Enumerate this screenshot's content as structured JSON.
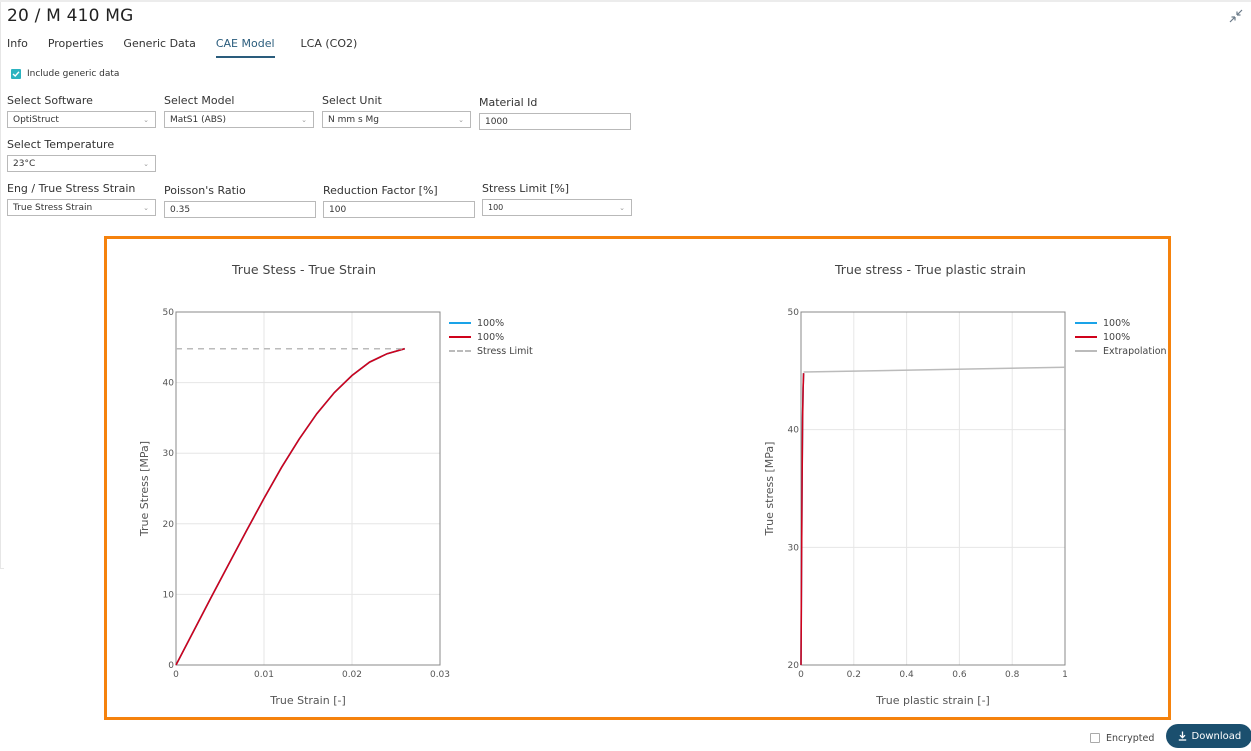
{
  "header": {
    "title": "20 / M 410 MG",
    "collapse_icon": "collapse-arrows-icon"
  },
  "tabs": [
    {
      "label": "Info",
      "active": false
    },
    {
      "label": "Properties",
      "active": false
    },
    {
      "label": "Generic Data",
      "active": false
    },
    {
      "label": "CAE Model",
      "active": true
    },
    {
      "label": "LCA (CO2)",
      "active": false
    }
  ],
  "include_generic": {
    "label": "Include generic data",
    "checked": true
  },
  "form": {
    "software": {
      "label": "Select Software",
      "value": "OptiStruct"
    },
    "model": {
      "label": "Select Model",
      "value": "MatS1 (ABS)"
    },
    "unit": {
      "label": "Select Unit",
      "value": "N mm s Mg"
    },
    "material_id": {
      "label": "Material Id",
      "value": "1000"
    },
    "temperature": {
      "label": "Select Temperature",
      "value": "23°C"
    },
    "stress_strain": {
      "label": "Eng / True Stress Strain",
      "value": "True Stress Strain"
    },
    "poisson": {
      "label": "Poisson's Ratio",
      "value": "0.35"
    },
    "reduction": {
      "label": "Reduction Factor [%]",
      "value": "100"
    },
    "stress_limit": {
      "label": "Stress Limit [%]",
      "value": "100"
    }
  },
  "colors": {
    "accent": "#2a5c7c",
    "checkbox": "#2bb3c0",
    "highlight_border": "#f5820d",
    "series_blue": "#1aa3e8",
    "series_red": "#d0021b",
    "gray": "#bbbbbb",
    "download_bg": "#1b4f6e"
  },
  "chart_data": [
    {
      "type": "line",
      "title": "True Stess - True Strain",
      "xlabel": "True Strain [-]",
      "ylabel": "True Stress [MPa]",
      "xlim": [
        0,
        0.03
      ],
      "ylim": [
        0,
        50
      ],
      "xticks": [
        "0",
        "0.01",
        "0.02",
        "0.03"
      ],
      "yticks": [
        "0",
        "10",
        "20",
        "30",
        "40",
        "50"
      ],
      "grid": true,
      "legend_position": "right",
      "series": [
        {
          "name": "100%",
          "color": "#1aa3e8",
          "style": "solid",
          "x": [
            0,
            0.002,
            0.004,
            0.006,
            0.008,
            0.01,
            0.012,
            0.014,
            0.016,
            0.018,
            0.02,
            0.022,
            0.024,
            0.026
          ],
          "y": [
            0,
            4.8,
            9.6,
            14.3,
            19.0,
            23.6,
            28.0,
            32.0,
            35.6,
            38.6,
            41.0,
            42.9,
            44.1,
            44.8
          ]
        },
        {
          "name": "100%",
          "color": "#d0021b",
          "style": "solid",
          "x": [
            0,
            0.002,
            0.004,
            0.006,
            0.008,
            0.01,
            0.012,
            0.014,
            0.016,
            0.018,
            0.02,
            0.022,
            0.024,
            0.026
          ],
          "y": [
            0,
            4.8,
            9.6,
            14.3,
            19.0,
            23.6,
            28.0,
            32.0,
            35.6,
            38.6,
            41.0,
            42.9,
            44.1,
            44.8
          ]
        },
        {
          "name": "Stress Limit",
          "color": "#bbbbbb",
          "style": "dashed",
          "x": [
            0,
            0.026
          ],
          "y": [
            44.8,
            44.8
          ]
        }
      ]
    },
    {
      "type": "line",
      "title": "True stress - True plastic strain",
      "xlabel": "True plastic strain [-]",
      "ylabel": "True stress [MPa]",
      "xlim": [
        0,
        1
      ],
      "ylim": [
        20,
        50
      ],
      "xticks": [
        "0",
        "0.2",
        "0.4",
        "0.6",
        "0.8",
        "1"
      ],
      "yticks": [
        "20",
        "30",
        "40",
        "50"
      ],
      "grid": true,
      "legend_position": "right",
      "series": [
        {
          "name": "100%",
          "color": "#1aa3e8",
          "style": "solid",
          "x": [
            0,
            0.002,
            0.004,
            0.006,
            0.008,
            0.01
          ],
          "y": [
            20,
            28,
            36,
            41,
            43.5,
            44.8
          ]
        },
        {
          "name": "100%",
          "color": "#d0021b",
          "style": "solid",
          "x": [
            0,
            0.002,
            0.004,
            0.006,
            0.008,
            0.01
          ],
          "y": [
            20,
            28,
            36,
            41,
            43.5,
            44.8
          ]
        },
        {
          "name": "Extrapolation",
          "color": "#bbbbbb",
          "style": "solid",
          "x": [
            0.01,
            1
          ],
          "y": [
            44.9,
            45.3
          ]
        }
      ]
    }
  ],
  "footer": {
    "encrypted": {
      "label": "Encrypted",
      "checked": false
    },
    "download_label": "Download",
    "download_icon": "download-icon"
  }
}
